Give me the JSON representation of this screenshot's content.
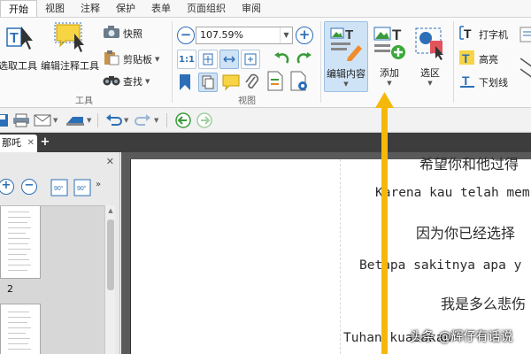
{
  "menubar": {
    "tabs": [
      "开始",
      "视图",
      "注释",
      "保护",
      "表单",
      "页面组织",
      "审阅"
    ]
  },
  "ribbon": {
    "tools_group": {
      "title": "工具",
      "select_tool_label": "选取工具",
      "annotate_tool_label": "编辑注释工具",
      "snapshot_label": "快照",
      "clipboard_label": "剪贴板",
      "find_label": "查找"
    },
    "view_group": {
      "title": "视图",
      "zoom_value": "107.59%"
    },
    "edit_group": {
      "edit_content_label": "编辑内容",
      "add_label": "添加",
      "select_area_label": "选区",
      "typewriter_label": "打字机",
      "highlight_label": "高亮",
      "underline_label": "下划线"
    }
  },
  "document": {
    "tab_title": "那吒",
    "page_number": "2",
    "lines": [
      {
        "text": "希望你和他过得",
        "kind": "cn"
      },
      {
        "text": "Karena kau telah mem",
        "kind": "lat"
      },
      {
        "text": "因为你已经选择",
        "kind": "cn"
      },
      {
        "text": "Betapa sakitnya apa y",
        "kind": "lat"
      },
      {
        "text": "我是多么悲伤",
        "kind": "cn"
      },
      {
        "text": "Tuhan kuasakan",
        "kind": "lat"
      }
    ]
  },
  "watermark": "头条 @辉仔有话说",
  "colors": {
    "accent_blue": "#2c6fb7",
    "arrow_yellow": "#f5b80a",
    "tab_bar_dark": "#3d3d3d",
    "selected_bg": "#cfe3f6"
  }
}
